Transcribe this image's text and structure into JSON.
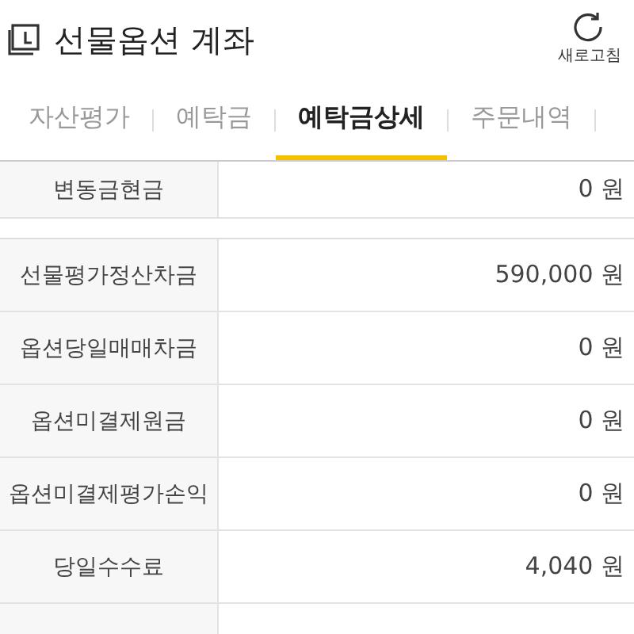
{
  "header": {
    "title": "선물옵션 계좌",
    "refresh_label": "새로고침"
  },
  "tabs": [
    {
      "label": "자산평가",
      "selected": false
    },
    {
      "label": "예탁금",
      "selected": false
    },
    {
      "label": "예탁금상세",
      "selected": true
    },
    {
      "label": "주문내역",
      "selected": false
    }
  ],
  "table_top": [
    {
      "label": "변동금현금",
      "value": "0 원"
    }
  ],
  "table": [
    {
      "label": "선물평가정산차금",
      "value": "590,000 원"
    },
    {
      "label": "옵션당일매매차금",
      "value": "0 원"
    },
    {
      "label": "옵션미결제원금",
      "value": "0 원"
    },
    {
      "label": "옵션미결제평가손익",
      "value": "0 원"
    },
    {
      "label": "당일수수료",
      "value": "4,040 원"
    }
  ]
}
